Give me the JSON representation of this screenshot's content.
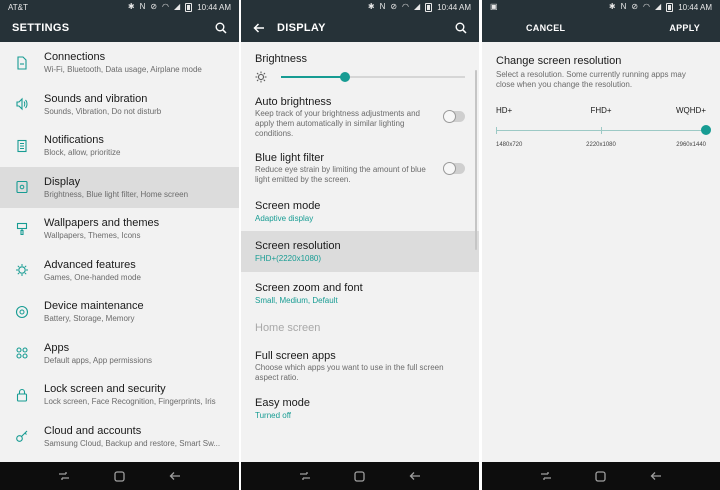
{
  "status": {
    "carrier": "AT&T",
    "time": "10:44 AM",
    "signal": "4G"
  },
  "panel1": {
    "title": "SETTINGS",
    "items": [
      {
        "icon": "connections-icon",
        "title": "Connections",
        "subtitle": "Wi-Fi, Bluetooth, Data usage, Airplane mode"
      },
      {
        "icon": "sound-icon",
        "title": "Sounds and vibration",
        "subtitle": "Sounds, Vibration, Do not disturb"
      },
      {
        "icon": "notifications-icon",
        "title": "Notifications",
        "subtitle": "Block, allow, prioritize"
      },
      {
        "icon": "display-icon",
        "title": "Display",
        "subtitle": "Brightness, Blue light filter, Home screen",
        "selected": true
      },
      {
        "icon": "brush-icon",
        "title": "Wallpapers and themes",
        "subtitle": "Wallpapers, Themes, Icons"
      },
      {
        "icon": "gear-plus-icon",
        "title": "Advanced features",
        "subtitle": "Games, One-handed mode"
      },
      {
        "icon": "maintenance-icon",
        "title": "Device maintenance",
        "subtitle": "Battery, Storage, Memory"
      },
      {
        "icon": "apps-icon",
        "title": "Apps",
        "subtitle": "Default apps, App permissions"
      },
      {
        "icon": "lock-icon",
        "title": "Lock screen and security",
        "subtitle": "Lock screen, Face Recognition, Fingerprints, Iris"
      },
      {
        "icon": "key-icon",
        "title": "Cloud and accounts",
        "subtitle": "Samsung Cloud, Backup and restore, Smart Sw..."
      }
    ]
  },
  "panel2": {
    "title": "DISPLAY",
    "brightness": {
      "label": "Brightness",
      "level": 0.35
    },
    "auto_brightness": {
      "title": "Auto brightness",
      "desc": "Keep track of your brightness adjustments and apply them automatically in similar lighting conditions."
    },
    "blue_light": {
      "title": "Blue light filter",
      "desc": "Reduce eye strain by limiting the amount of blue light emitted by the screen."
    },
    "screen_mode": {
      "title": "Screen mode",
      "value": "Adaptive display"
    },
    "screen_resolution": {
      "title": "Screen resolution",
      "value": "FHD+(2220x1080)"
    },
    "zoom_font": {
      "title": "Screen zoom and font",
      "value": "Small, Medium, Default"
    },
    "home_screen": {
      "title": "Home screen"
    },
    "full_screen_apps": {
      "title": "Full screen apps",
      "desc": "Choose which apps you want to use in the full screen aspect ratio."
    },
    "easy_mode": {
      "title": "Easy mode",
      "value": "Turned off"
    }
  },
  "panel3": {
    "cancel": "CANCEL",
    "apply": "APPLY",
    "title": "Change screen resolution",
    "desc": "Select a resolution. Some currently running apps may close when you change the resolution.",
    "options": [
      {
        "label": "HD+",
        "res": "1480x720"
      },
      {
        "label": "FHD+",
        "res": "2220x1080"
      },
      {
        "label": "WQHD+",
        "res": "2960x1440"
      }
    ],
    "selected_index": 2
  }
}
